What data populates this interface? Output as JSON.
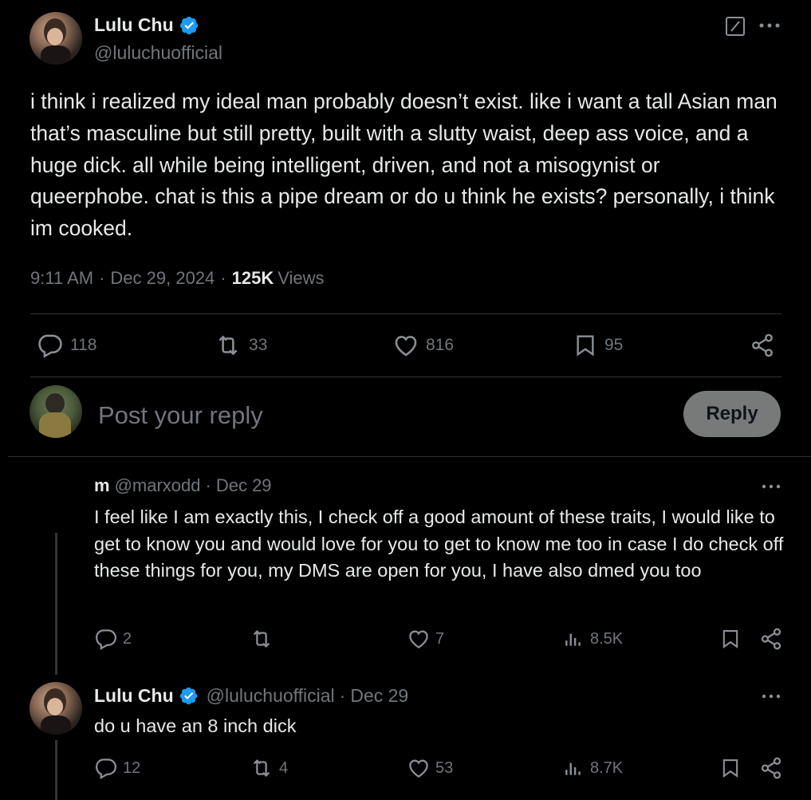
{
  "main_post": {
    "author_name": "Lulu Chu",
    "handle": "@luluchuofficial",
    "text": "i think i realized my ideal man probably doesn’t exist. like i want a tall Asian man that’s masculine but still pretty, built with a slutty waist, deep ass voice, and a huge dick. all while being intelligent, driven, and not a misogynist or queerphobe. chat is this a pipe dream or do u think he exists? personally, i think im cooked.",
    "time": "9:11 AM",
    "date": "Dec 29, 2024",
    "views_count": "125K",
    "views_label": "Views",
    "sep": "·",
    "replies": "118",
    "reposts": "33",
    "likes": "816",
    "bookmarks": "95"
  },
  "composer": {
    "placeholder": "Post your reply",
    "reply_label": "Reply"
  },
  "replies": [
    {
      "author_name": "m",
      "handle": "@marxodd",
      "sep": "·",
      "date": "Dec 29",
      "text": "I feel like I am exactly this, I check off a good amount of these traits, I would like to get to know you and would love for you to get to know me too in case I do check off these things for you, my DMS are open for you, I have also dmed you too",
      "replies": "2",
      "reposts": "",
      "likes": "7",
      "views": "8.5K"
    },
    {
      "author_name": "Lulu Chu",
      "handle": "@luluchuofficial",
      "sep": "·",
      "date": "Dec 29",
      "text": "do u have an 8 inch dick",
      "replies": "12",
      "reposts": "4",
      "likes": "53",
      "views": "8.7K"
    }
  ],
  "icons": {
    "verified": "verified-badge-icon",
    "more": "more-icon",
    "grok": "grok-icon",
    "reply": "reply-icon",
    "repost": "repost-icon",
    "like": "like-icon",
    "bookmark": "bookmark-icon",
    "share": "share-icon",
    "views": "views-icon"
  },
  "colors": {
    "background": "#000000",
    "text": "#e7e9ea",
    "muted": "#71767b",
    "verified": "#1d9bf0",
    "divider": "#2f3336"
  }
}
